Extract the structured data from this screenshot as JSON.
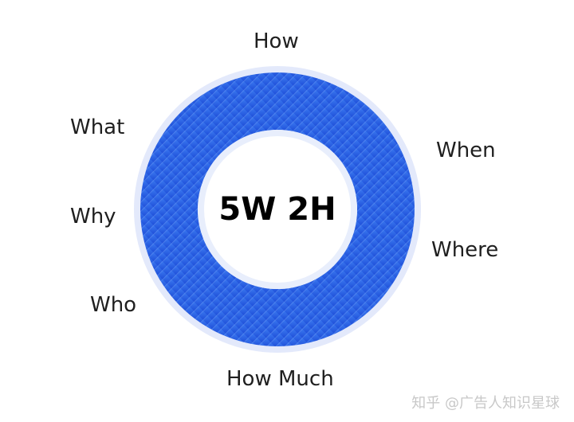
{
  "diagram": {
    "center_title": "5W 2H",
    "labels": {
      "how": "How",
      "what": "What",
      "when": "When",
      "why": "Why",
      "where": "Where",
      "who": "Who",
      "how_much": "How Much"
    },
    "colors": {
      "ring_light": "#3a78ef",
      "ring_dark": "#1f4fd9",
      "halo": "#e3e9fb",
      "text": "#1f1f1f"
    }
  },
  "watermark": "知乎 @广告人知识星球"
}
